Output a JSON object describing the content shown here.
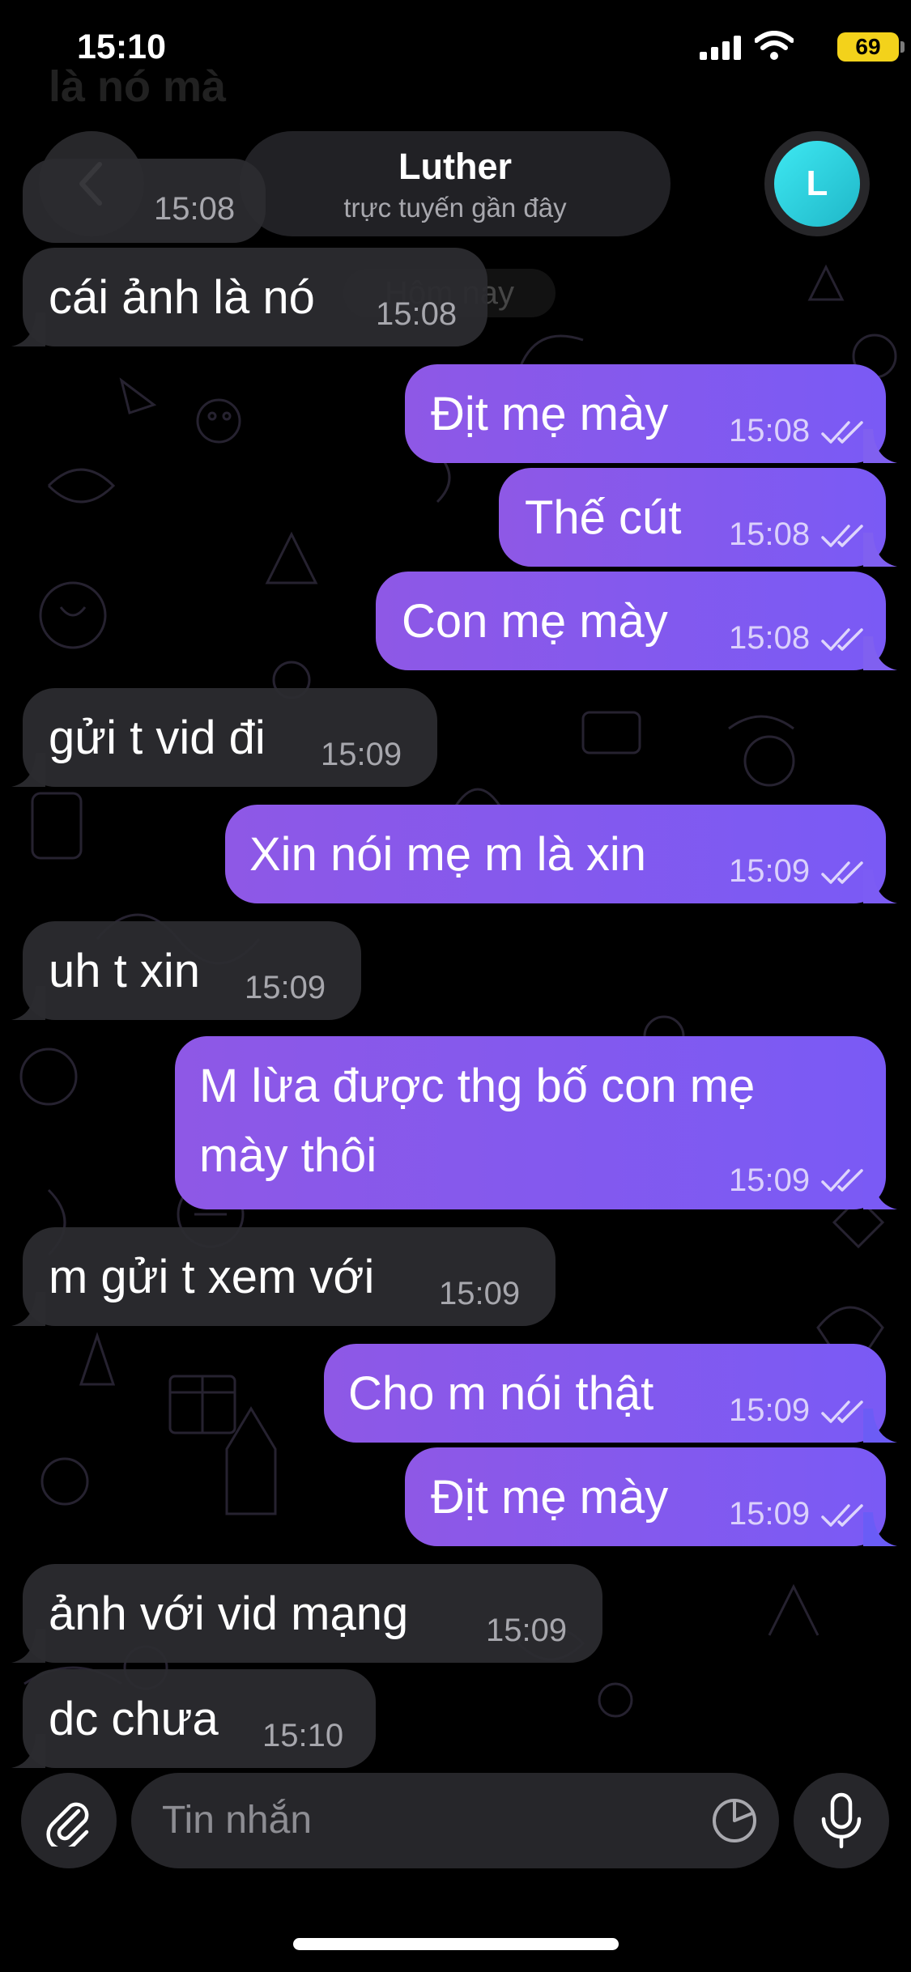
{
  "status_bar": {
    "time": "15:10",
    "battery": "69"
  },
  "header": {
    "ghost_text": "là nó mà",
    "contact_name": "Luther",
    "contact_status": "trực tuyến gần đây",
    "avatar_letter": "L",
    "date_chip": "Hôm nay"
  },
  "messages": [
    {
      "dir": "in",
      "text": "15:08",
      "time": ""
    },
    {
      "dir": "in",
      "text": "cái ảnh là nó",
      "time": "15:08"
    },
    {
      "dir": "out",
      "text": "Địt mẹ mày",
      "time": "15:08"
    },
    {
      "dir": "out",
      "text": "Thế cút",
      "time": "15:08"
    },
    {
      "dir": "out",
      "text": "Con mẹ mày",
      "time": "15:08"
    },
    {
      "dir": "in",
      "text": "gửi t vid đi",
      "time": "15:09"
    },
    {
      "dir": "out",
      "text": "Xin nói mẹ m là xin",
      "time": "15:09"
    },
    {
      "dir": "in",
      "text": "uh t xin",
      "time": "15:09"
    },
    {
      "dir": "out",
      "line1": "M lừa được thg bố con mẹ",
      "line2": "mày thôi",
      "time": "15:09"
    },
    {
      "dir": "in",
      "text": "m gửi t xem với",
      "time": "15:09"
    },
    {
      "dir": "out",
      "text": "Cho m nói thật",
      "time": "15:09"
    },
    {
      "dir": "out",
      "text": "Địt mẹ mày",
      "time": "15:09"
    },
    {
      "dir": "in",
      "text": "ảnh với vid mạng",
      "time": "15:09"
    },
    {
      "dir": "in",
      "text": "dc chưa",
      "time": "15:10"
    }
  ],
  "input_bar": {
    "placeholder": "Tin nhắn"
  },
  "icons": {
    "back": "chevron-left-icon",
    "attach": "paperclip-icon",
    "sticker": "sticker-icon",
    "mic": "microphone-icon",
    "read_receipt": "double-check-icon"
  },
  "colors": {
    "outgoing_start": "#8e58e6",
    "outgoing_end": "#7a5af5",
    "incoming": "#2c2c30",
    "avatar": "#2fd4e0",
    "battery": "#f3d21b"
  }
}
